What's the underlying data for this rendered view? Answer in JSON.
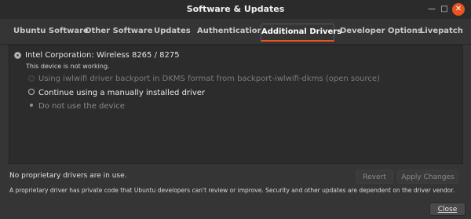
{
  "window": {
    "title": "Software & Updates",
    "controls": {
      "minimize": "—",
      "maximize": "□",
      "close": "✕"
    },
    "accent": "#e95420"
  },
  "tabs": [
    {
      "label": "Ubuntu Software",
      "active": false
    },
    {
      "label": "Other Software",
      "active": false
    },
    {
      "label": "Updates",
      "active": false
    },
    {
      "label": "Authentication",
      "active": false
    },
    {
      "label": "Additional Drivers",
      "active": true
    },
    {
      "label": "Developer Options",
      "active": false
    },
    {
      "label": "Livepatch",
      "active": false
    }
  ],
  "drivers": {
    "device_name": "Intel Corporation: Wireless 8265 / 8275",
    "device_status": "This device is not working.",
    "options": [
      {
        "label": "Using iwlwifi driver backport in DKMS format from backport-iwlwifi-dkms (open source)",
        "enabled": false,
        "selected": false
      },
      {
        "label": "Continue using a manually installed driver",
        "enabled": true,
        "selected": false
      },
      {
        "label": "Do not use the device",
        "enabled": false,
        "selected": true
      }
    ]
  },
  "footer": {
    "status": "No proprietary drivers are in use.",
    "revert_label": "Revert",
    "apply_label": "Apply Changes",
    "note": "A proprietary driver has private code that Ubuntu developers can't review or improve. Security and other updates are dependent on the driver vendor.",
    "close_label": "Close"
  }
}
